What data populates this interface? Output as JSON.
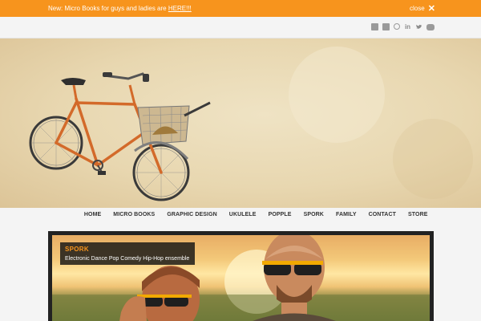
{
  "notice": {
    "text": "New: Micro Books for guys and ladies are",
    "link": "HERE!!!",
    "close_label": "close",
    "close_glyph": "✕"
  },
  "social": {
    "icons": [
      "facebook-icon",
      "website-icon",
      "pinterest-icon",
      "linkedin-icon",
      "twitter-icon",
      "youtube-icon"
    ]
  },
  "colors": {
    "accent": "#f7941d",
    "nav_text": "#333333",
    "caption_bg": "#141414"
  },
  "nav": {
    "items": [
      "HOME",
      "MICRO BOOKS",
      "GRAPHIC DESIGN",
      "UKULELE",
      "POPPLE",
      "SPORK",
      "FAMILY",
      "CONTACT",
      "STORE"
    ]
  },
  "slider": {
    "title": "SPORK",
    "subtitle": "Electronic Dance Pop Comedy Hip-Hop ensemble"
  }
}
